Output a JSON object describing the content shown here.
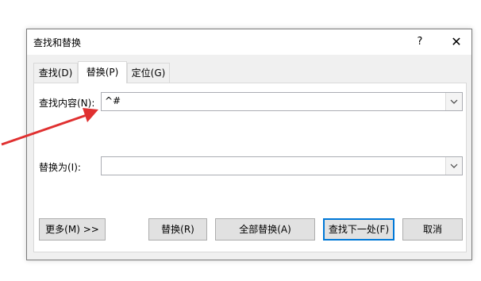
{
  "window": {
    "title": "查找和替换",
    "help_label": "?",
    "close_label": "✕"
  },
  "tabs": [
    {
      "label": "查找(D)",
      "active": false
    },
    {
      "label": "替换(P)",
      "active": true
    },
    {
      "label": "定位(G)",
      "active": false
    }
  ],
  "find": {
    "label": "查找内容(N):",
    "value": "^#"
  },
  "replace": {
    "label": "替换为(I):",
    "value": ""
  },
  "buttons": {
    "more": "更多(M) >>",
    "replace": "替换(R)",
    "replace_all": "全部替换(A)",
    "find_next": "查找下一处(F)",
    "cancel": "取消"
  },
  "colors": {
    "annotation_arrow": "#e03030",
    "default_button_border": "#0078d7"
  }
}
